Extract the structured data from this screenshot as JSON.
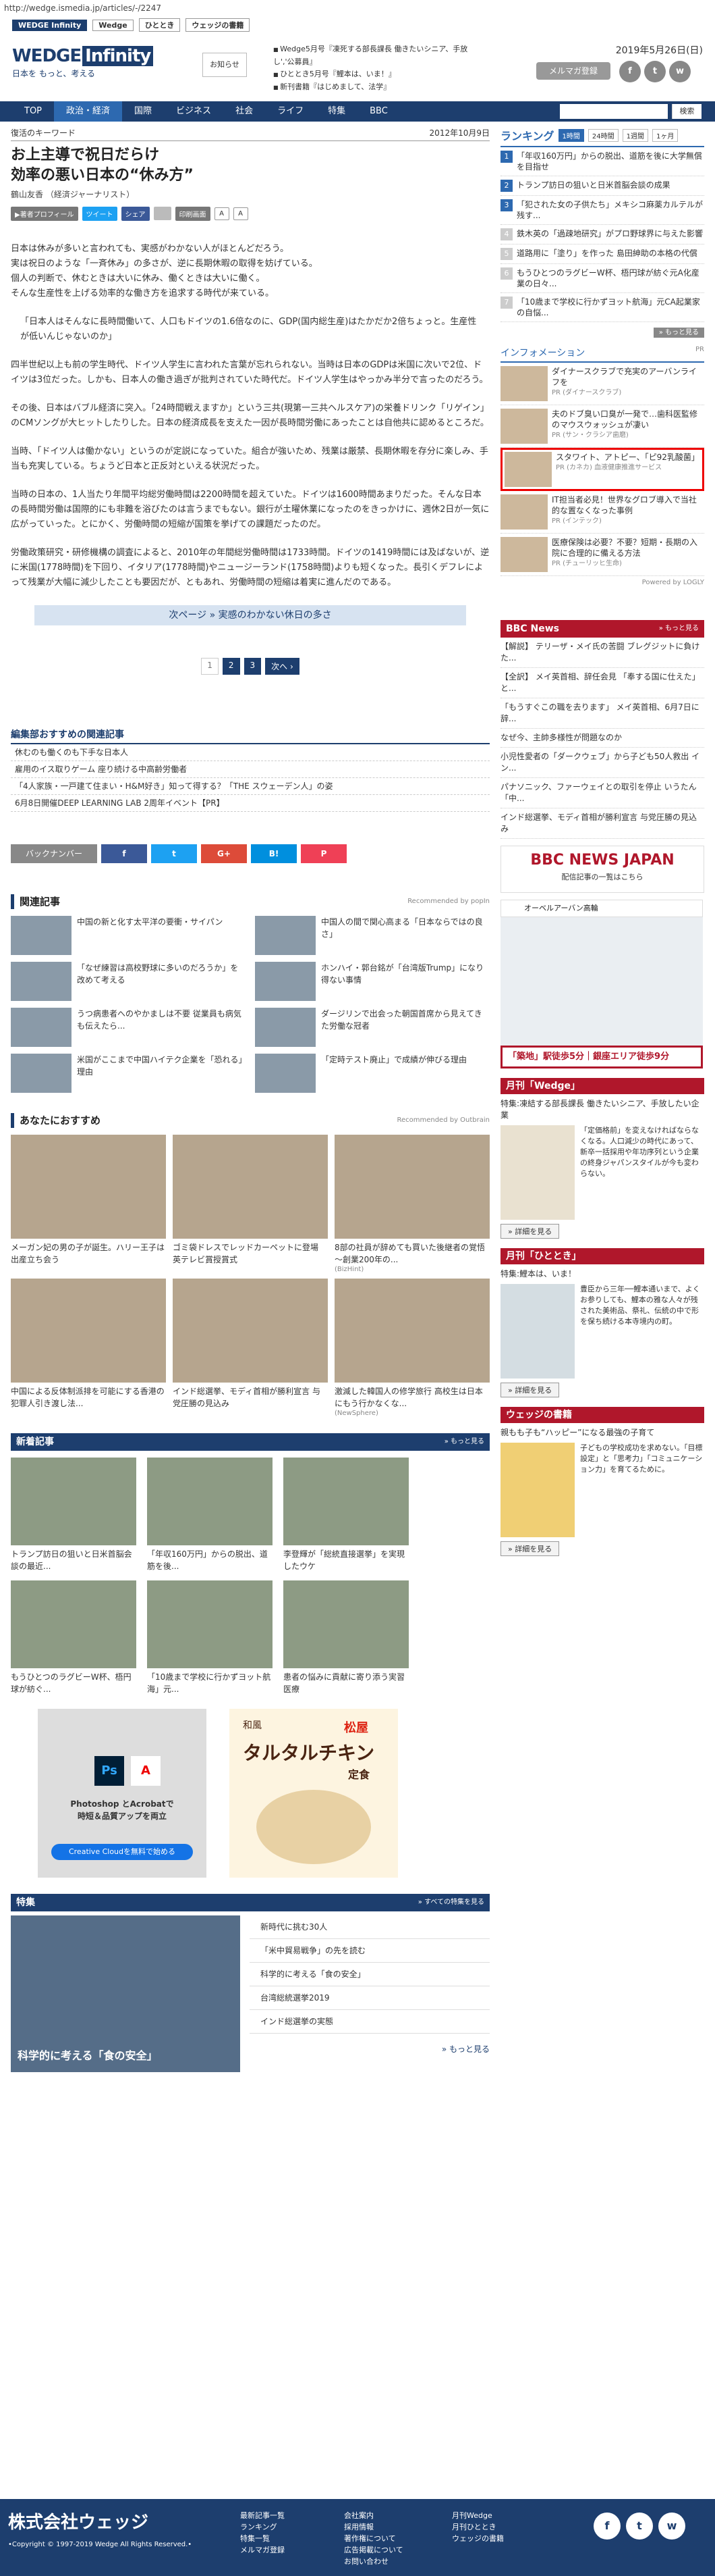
{
  "url": "http://wedge.ismedia.jp/articles/-/2247",
  "sites": [
    "WEDGE Infinity",
    "Wedge",
    "ひととき",
    "ウェッジの書籍"
  ],
  "header": {
    "logo_main": "WEDGE",
    "logo_accent": "Infinity",
    "logo_sub": "日本を もっと、考える",
    "notice": "お知らせ",
    "news": [
      "Wedge5月号『凍死する部長課長 働きたいシニア、手放し','公募員』",
      "ひととき5月号『鯉本は、いま！』",
      "新刊書籍『はじめまして、法学』"
    ],
    "date": "2019年5月26日(日)",
    "mail_btn": "メルマガ登録",
    "social": [
      "f",
      "t",
      "w"
    ]
  },
  "nav": {
    "items": [
      "TOP",
      "政治・経済",
      "国際",
      "ビジネス",
      "社会",
      "ライフ",
      "特集",
      "BBC"
    ],
    "active": 1,
    "search_btn": "検索"
  },
  "article": {
    "keyword": "復活のキーワード",
    "date": "2012年10月9日",
    "title_lines": [
      "お上主導で祝日だらけ",
      "効率の悪い日本の“休み方”"
    ],
    "author": "鶴山友香 （経済ジャーナリスト）",
    "share": {
      "profile": "▶著者プロフィール",
      "tweet": "ツイート",
      "share": "シェア",
      "print": "印刷画面",
      "a_small": "A",
      "a_large": "A"
    },
    "paragraphs": [
      "日本は休みが多いと言われても、実感がわかない人がほとんどだろう。\n実は祝日のような「一斉休み」の多さが、逆に長期休暇の取得を妨げている。\n個人の判断で、休むときは大いに休み、働くときは大いに働く。\nそんな生産性を上げる効率的な働き方を追求する時代が来ている。",
      "「日本人はそんなに長時間働いて、人口もドイツの1.6倍なのに、GDP(国内総生産)はたかだか2倍ちょっと。生産性が低いんじゃないのか」",
      "四半世紀以上も前の学生時代、ドイツ人学生に言われた言葉が忘れられない。当時は日本のGDPは米国に次いで2位、ドイツは3位だった。しかも、日本人の働き過ぎが批判されていた時代だ。ドイツ人学生はやっかみ半分で言ったのだろう。",
      "その後、日本はバブル経済に突入。「24時間戦えますか」という三共(現第一三共ヘルスケア)の栄養ドリンク「リゲイン」のCMソングが大ヒットしたりした。日本の経済成長を支えた一因が長時間労働にあったことは自他共に認めるところだ。",
      "当時、「ドイツ人は働かない」というのが定説になっていた。組合が強いため、残業は厳禁、長期休暇を存分に楽しみ、手当も充実している。ちょうど日本と正反対といえる状況だった。",
      "当時の日本の、1人当たり年間平均総労働時間は2200時間を超えていた。ドイツは1600時間あまりだった。そんな日本の長時間労働は国際的にも非難を浴びたのは言うまでもない。銀行が土曜休業になったのをきっかけに、週休2日が一気に広がっていった。とにかく、労働時間の短縮が国策を挙げての課題だったのだ。",
      "労働政策研究・研修機構の調査によると、2010年の年間総労働時間は1733時間。ドイツの1419時間には及ばないが、逆に米国(1778時間)を下回り、イタリア(1778時間)やニュージーランド(1758時間)よりも短くなった。長引くデフレによって残業が大幅に減少したことも要因だが、ともあれ、労働時間の短縮は着実に進んだのである。"
    ],
    "next_page": "次ページ » 実感のわかない休日の多さ",
    "pager": [
      "1",
      "2",
      "3",
      "次へ ›"
    ]
  },
  "related_editor": {
    "title": "編集部おすすめの関連記事",
    "items": [
      "休むのも働くのも下手な日本人",
      "雇用のイス取りゲーム 座り続ける中高齢労働者",
      "「4人家族・一戸建て住まい・H&M好き」知って得する？「THE スウェーデン人」の姿",
      "6月8日開催DEEP LEARNING LAB 2周年イベント【PR】"
    ]
  },
  "backbar": {
    "back": "バックナンバー",
    "buttons": [
      "f",
      "t",
      "G+",
      "B!",
      "P"
    ]
  },
  "kanren": {
    "title": "関連記事",
    "note": "Recommended by popIn",
    "items": [
      "中国の新と化す太平洋の要衝・サイパン",
      "中国人の間で関心高まる「日本ならではの良さ」",
      "「なぜ練習は高校野球に多いのだろうか」を改めて考える",
      "ホンハイ・郭台銘が「台湾版Trump」になり得ない事情",
      "うつ病患者へのやかましは不要 従業員も病気も伝えたら...",
      "ダージリンで出会った朝国首席から見えてきた労働な冠者",
      "米国がここまで中国ハイテク企業を「恐れる」理由",
      "「定時テスト廃止」で成績が伸びる理由"
    ]
  },
  "recommend": {
    "title": "あなたにおすすめ",
    "note": "Recommended by Outbrain",
    "items": [
      {
        "text": "メーガン妃の男の子が誕生。ハリー王子は出産立ち会う",
        "src": ""
      },
      {
        "text": "ゴミ袋ドレスでレッドカーペットに登場 英テレビ賞授賞式",
        "src": ""
      },
      {
        "text": "8部の社員が辞めても買いた後継者の覚悟 ～創業200年の...",
        "src": "(BizHint)"
      },
      {
        "text": "中国による反体制派排を可能にする香港の犯罪人引き渡し法...",
        "src": ""
      },
      {
        "text": "インド総選挙、モディ首相が勝利宣言 与党圧勝の見込み",
        "src": ""
      },
      {
        "text": "激減した韓国人の修学旅行 高校生は日本にもう行かなくな...",
        "src": "(NewSphere)"
      }
    ]
  },
  "new_articles": {
    "title": "新着記事",
    "more": "» もっと見る",
    "items": [
      "トランプ訪日の狙いと日米首脳会談の最近...",
      "「年収160万円」からの脱出、道筋を後...",
      "李登輝が「総統直接選挙」を実現したウケ",
      "もうひとつのラグビーW杯、梧円球が紡ぐ...",
      "「10歳まで学校に行かずヨット航海」元...",
      "患者の悩みに貢献に寄り添う実習医療"
    ]
  },
  "ads": {
    "ad1_line1": "Photoshop とAcrobatで",
    "ad1_line2": "時短＆品質アップを両立",
    "ad1_btn": "Creative Cloudを無料で始める",
    "ad2_brand": "和風",
    "ad2_title": "タルタルチキン",
    "ad2_sub": "定食",
    "ad2_shop": "松屋"
  },
  "tokushu": {
    "title": "特集",
    "more": "» すべての特集を見る",
    "caption": "科学的に考える「食の安全」",
    "items": [
      "新時代に挑む30人",
      "「米中貿易戦争」の先を読む",
      "科学的に考える「食の安全」",
      "台湾総統選挙2019",
      "インド総選挙の実態"
    ],
    "more2": "» もっと見る"
  },
  "ranking": {
    "title": "ランキング",
    "tabs": [
      "1時間",
      "24時間",
      "1週間",
      "1ヶ月"
    ],
    "items": [
      "「年収160万円」からの脱出、道筋を後に大学無償を目指せ",
      "トランプ訪日の狙いと日米首脳会談の成果",
      "「犯された女の子供たち」メキシコ麻薬カルテルが残す...",
      "鉄木英の「過疎地研究」がプロ野球界に与えた影響",
      "道路用に「塗り」を作った 島田紳助の本格の代償",
      "もうひとつのラグビーW杯、梧円球が紡ぐ元A化産業の日々...",
      "「10歳まで学校に行かずヨット航海」元CA起業家の自悩..."
    ],
    "more": "» もっと見る"
  },
  "info": {
    "title": "インフォメーション",
    "pr": "PR",
    "items": [
      {
        "text": "ダイナースクラブで充実のアーバンライフを",
        "src": "PR (ダイナースクラブ)"
      },
      {
        "text": "夫のドブ臭い口臭が一発で…歯科医監修のマウスウォッシュが凄い",
        "src": "PR (サン・クラシア歯磨)"
      },
      {
        "text": "スタワイト、アトピー、「ピ92乳酸菌」",
        "src": "PR (カネカ) 血液健康推進サービス"
      },
      {
        "text": "IT担当者必見！世界なグロブ導入で当社的な置なくなった事例",
        "src": "PR (インテック)"
      },
      {
        "text": "医療保険は必要？不要？短期・長期の入院に合理的に備える方法",
        "src": "PR (チューリッヒ生命)"
      }
    ],
    "powered": "Powered by LOGLY"
  },
  "bbc": {
    "title": "BBC News",
    "more": "» もっと見る",
    "items": [
      "【解説】 テリーザ・メイ氏の苦闘 ブレグジットに負けた...",
      "【全訳】 メイ英首相、辞任会見 「奉する国に仕えた」と...",
      "「もうすぐこの職を去ります」 メイ英首相、6月7日に辞...",
      "なぜ今、主帥多様性が問題なのか",
      "小児性愛者の「ダークウェブ」から子ども50人救出 イン...",
      "パナソニック、ファーウェイとの取引を停止 いうたん「中...",
      "インド総選挙、モディ首相が勝利宣言 与党圧勝の見込み"
    ],
    "logo": "BBC NEWS JAPAN",
    "logo_sub": "配信記事の一覧はこちら"
  },
  "side_ad": {
    "top": "オーベルアーバン高輪",
    "bottom": "「築地」駅徒歩5分｜銀座エリア徒歩9分"
  },
  "mag1": {
    "title": "月刊「Wedge」",
    "sub": "特集:凍結する部長課長 働きたいシニア、手放したい企業",
    "text": "「定価格前」を変えなければならなくなる。人口減少の時代にあって、新卒一括採用や年功序列という企業の終身ジャパンスタイルが今も変わらない。",
    "btn": "» 詳細を見る"
  },
  "mag2": {
    "title": "月刊「ひととき」",
    "sub": "特集:鯉本は、いま！",
    "text": "豊臣から三年──鯉本通いまで、よくお参りしても、鯉本の雅な人々が残された美術品、祭礼、伝統の中で形を保ち続ける本寺境内の町。",
    "btn": "» 詳細を見る"
  },
  "mag3": {
    "title": "ウェッジの書籍",
    "sub": "親もも子も“ハッピー”になる最強の子育て",
    "text": "子どもの学校成功を求めない。「目標設定」と「思考力」「コミュニケーション力」を育てるために。",
    "btn": "» 詳細を見る"
  },
  "footer": {
    "company": "株式会社ウェッジ",
    "copyright": "•Copyright © 1997-2019 Wedge All Rights Reserved.•",
    "col1": [
      "最新記事一覧",
      "ランキング",
      "特集一覧",
      "メルマガ登録"
    ],
    "col2": [
      "会社案内",
      "採用情報",
      "著作権について",
      "広告掲載について",
      "お問い合わせ"
    ],
    "col3": [
      "月刊Wedge",
      "月刊ひととき",
      "ウェッジの書籍"
    ],
    "social": [
      "f",
      "t",
      "w"
    ]
  }
}
